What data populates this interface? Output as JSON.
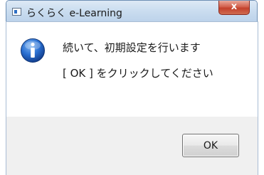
{
  "window": {
    "title": "らくらく e-Learning",
    "close_label": "x"
  },
  "dialog": {
    "icon": "info-icon",
    "message_line1": "続いて、初期設定を行います",
    "message_line2": "[ OK ] をクリックしてください"
  },
  "buttons": {
    "ok_label": "OK"
  },
  "colors": {
    "title_bar": "#c9dcef",
    "close_button": "#c3412c",
    "info_icon": "#1e63c8",
    "content_background": "#ffffff",
    "footer_background": "#f0f0f0"
  }
}
